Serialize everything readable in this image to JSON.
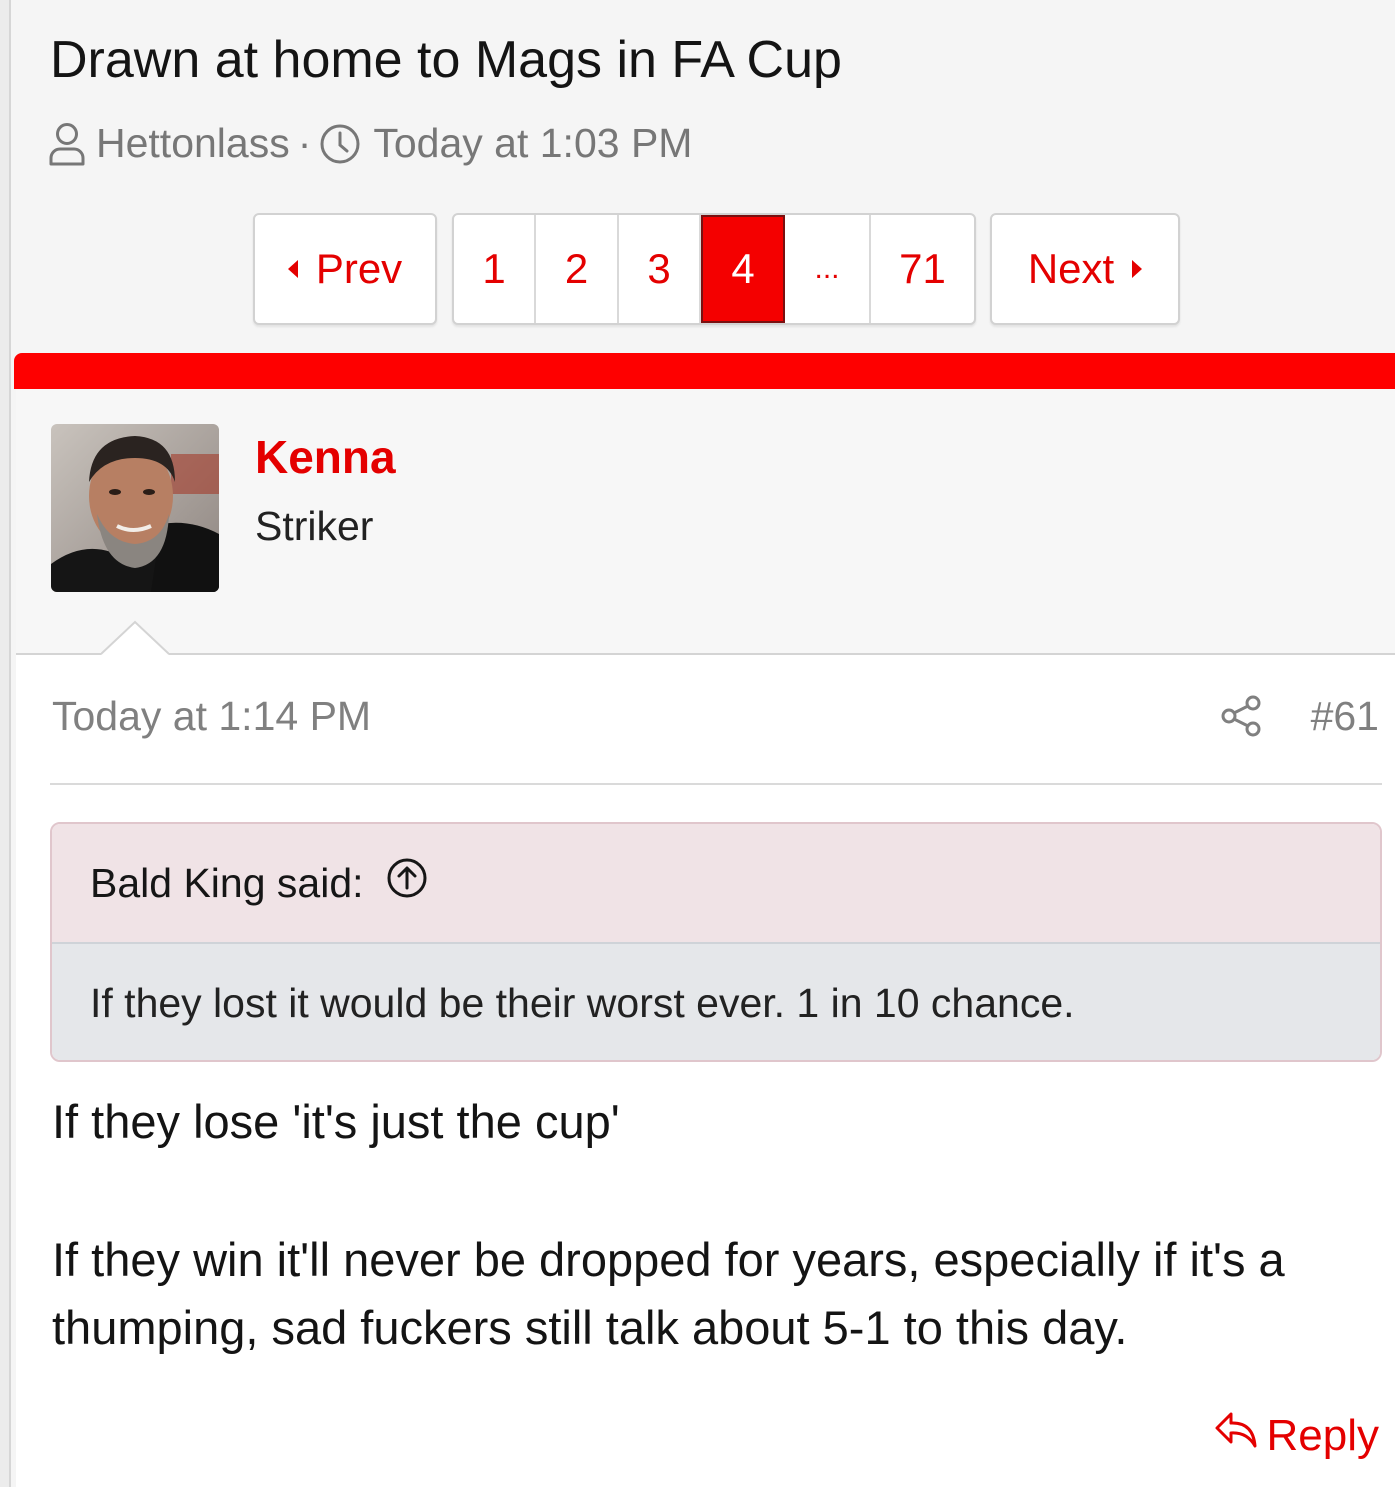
{
  "thread": {
    "title": "Drawn at home to Mags in FA Cup",
    "author": "Hettonlass",
    "separator": "·",
    "date": "Today at 1:03 PM"
  },
  "pagination": {
    "prev_label": "Prev",
    "next_label": "Next",
    "pages": [
      "1",
      "2",
      "3",
      "4",
      "...",
      "71"
    ],
    "current_page": "4"
  },
  "colors": {
    "accent": "#fe0000",
    "link": "#e40000",
    "quote_head_bg": "#f0e3e6",
    "quote_body_bg": "#e5e7ea"
  },
  "post": {
    "user": {
      "name": "Kenna",
      "title": "Striker"
    },
    "date": "Today at 1:14 PM",
    "number": "#61",
    "quote": {
      "attribution": "Bald King said:",
      "text": "If they lost it would be their worst ever. 1 in 10 chance."
    },
    "message": {
      "line1": "If they lose 'it's just the cup'",
      "line2": "If they win it'll never be dropped for years, especially if it's a",
      "line3": "thumping, sad fuckers still talk about 5-1 to this day."
    },
    "reply_label": "Reply"
  },
  "icons": {
    "author": "user-icon",
    "date": "clock-icon",
    "share": "share-icon",
    "quote_jump": "arrow-up-circle-icon",
    "reply": "reply-icon"
  }
}
